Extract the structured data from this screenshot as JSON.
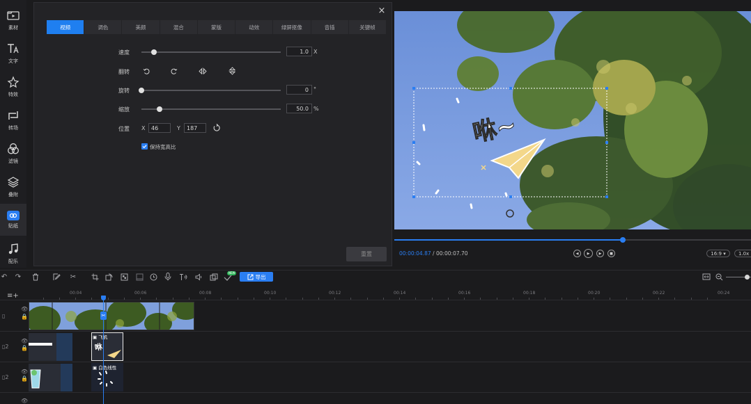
{
  "sidebar": {
    "items": [
      {
        "label": "素材",
        "icon": "folder-play-icon"
      },
      {
        "label": "文字",
        "icon": "text-icon"
      },
      {
        "label": "特效",
        "icon": "effects-icon"
      },
      {
        "label": "转场",
        "icon": "transition-icon"
      },
      {
        "label": "滤镜",
        "icon": "filter-icon"
      },
      {
        "label": "叠附",
        "icon": "overlay-icon"
      },
      {
        "label": "贴纸",
        "icon": "sticker-icon"
      },
      {
        "label": "配乐",
        "icon": "music-icon"
      }
    ],
    "active_index": 6
  },
  "panel": {
    "close_icon": "close-icon",
    "tabs": [
      "视频",
      "调色",
      "美颜",
      "混合",
      "蒙版",
      "动效",
      "绿屏抠像",
      "音插",
      "关键帧"
    ],
    "active_tab": 0,
    "speed": {
      "label": "速度",
      "value": "1.0",
      "unit": "X",
      "level": 0.0
    },
    "flip": {
      "label": "翻转",
      "icons": [
        "rotate-left-icon",
        "rotate-right-icon",
        "flip-horizontal-icon",
        "flip-vertical-icon"
      ]
    },
    "rotate": {
      "label": "旋转",
      "value": "0",
      "unit": "°",
      "level": 0.0
    },
    "scale": {
      "label": "缩放",
      "value": "50.0",
      "unit": "%",
      "level": 0.13
    },
    "position": {
      "label": "位置",
      "x_label": "X",
      "x_value": "46",
      "y_label": "Y",
      "y_value": "187",
      "reset_icon": "reset-position-icon"
    },
    "keep_ratio": {
      "label": "保持宽高比",
      "checked": true
    },
    "reset_button": "重置"
  },
  "preview": {
    "sticker_text": "咻~",
    "current_time": "00:00:04.87",
    "separator": "/",
    "total_time": "00:00:07.70",
    "progress": 0.64,
    "aspect_ratio": "16:9",
    "zoom": "1.0x"
  },
  "toolbar": {
    "export_label": "导出",
    "new_badge": "NEW"
  },
  "timeline": {
    "ticks": [
      "00:04",
      "00:06",
      "00:08",
      "00:10",
      "00:12",
      "00:14",
      "00:16",
      "00:18",
      "00:20",
      "00:22",
      "00:24"
    ],
    "clips": [
      {
        "track": "video",
        "label": ""
      },
      {
        "track": "sticker-1",
        "label": "飞机"
      },
      {
        "track": "sticker-2",
        "label": "白色线性"
      }
    ]
  },
  "colors": {
    "accent": "#2a7ef2",
    "panel_bg": "#232326",
    "app_bg": "#1b1b1d"
  }
}
